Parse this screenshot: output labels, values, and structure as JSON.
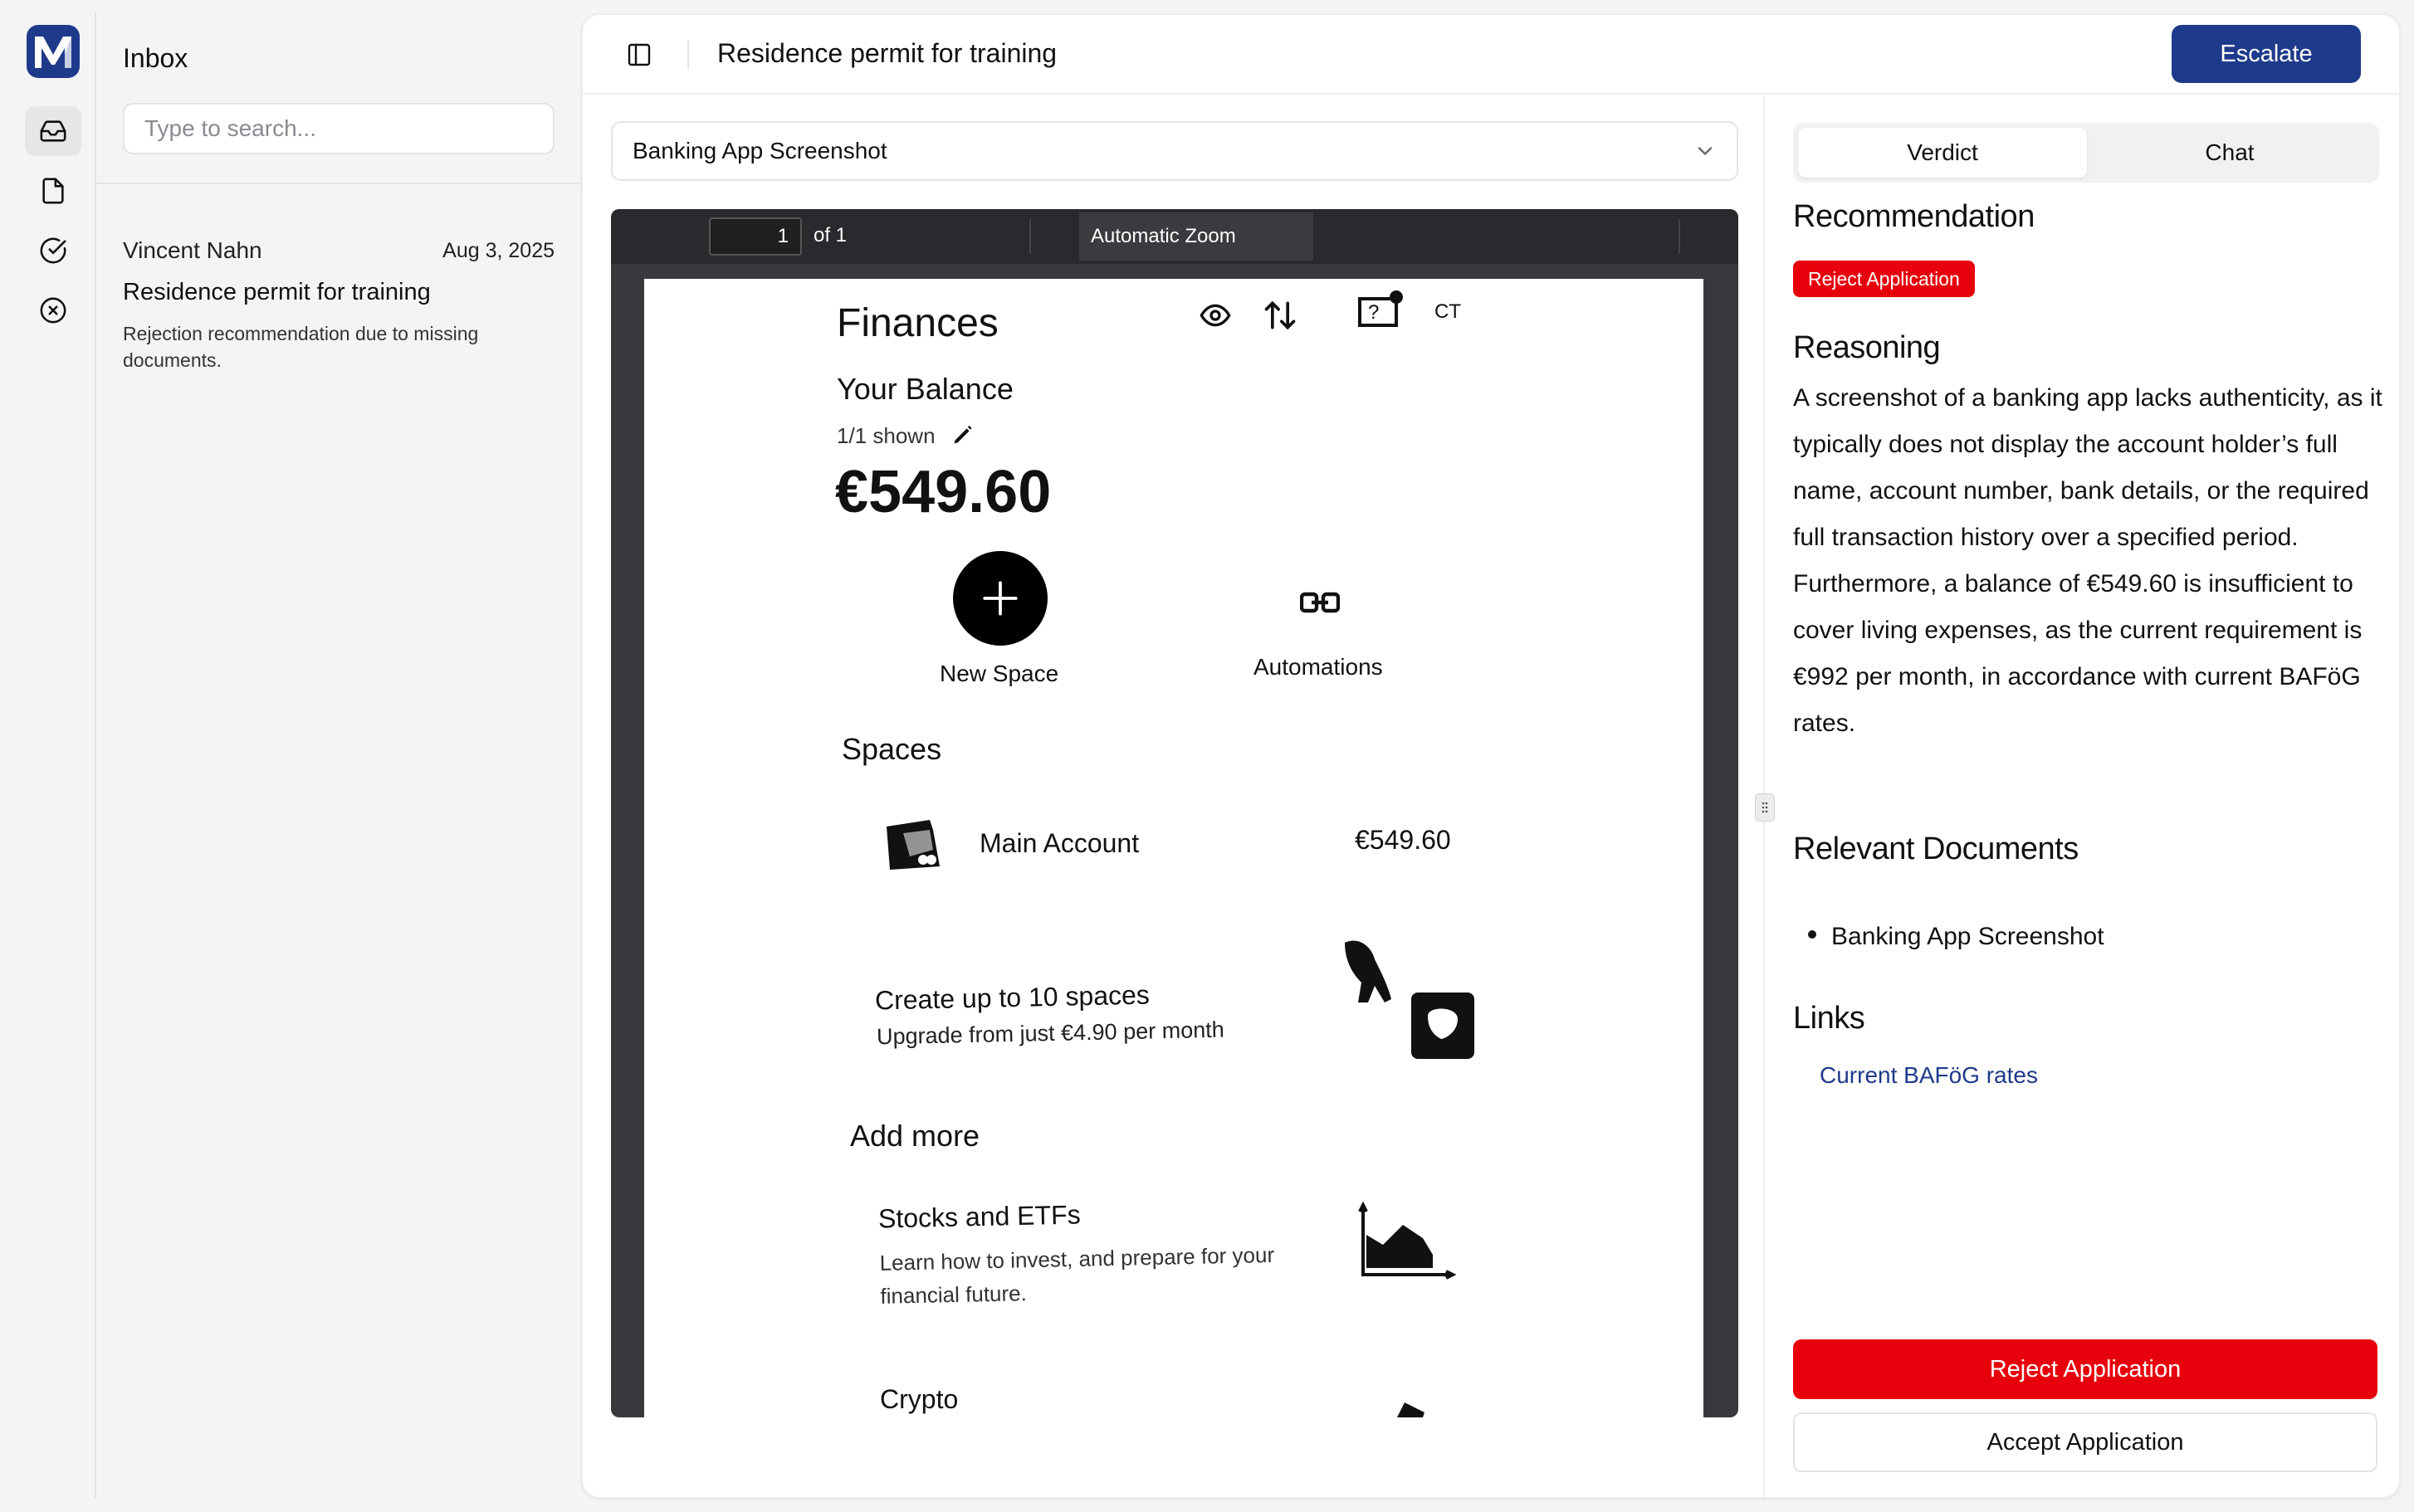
{
  "app": {
    "logo_icon": "logo-icon",
    "brand_color": "#1e3a8a"
  },
  "rail": {
    "items": [
      {
        "name": "inbox",
        "icon": "inbox-icon",
        "active": true
      },
      {
        "name": "documents",
        "icon": "file-icon",
        "active": false
      },
      {
        "name": "approved",
        "icon": "check-circle-icon",
        "active": false
      },
      {
        "name": "rejected",
        "icon": "x-circle-icon",
        "active": false
      }
    ]
  },
  "inbox": {
    "title": "Inbox",
    "search_placeholder": "Type to search...",
    "items": [
      {
        "sender": "Vincent Nahn",
        "date": "Aug 3, 2025",
        "title": "Residence permit for training",
        "snippet": "Rejection recommendation due to missing documents."
      }
    ]
  },
  "header": {
    "title": "Residence permit for training",
    "escalate_label": "Escalate"
  },
  "document": {
    "selected": "Banking App Screenshot",
    "viewer": {
      "page_number": "1",
      "page_of": "of 1",
      "zoom": "Automatic Zoom"
    },
    "page": {
      "finances": "Finances",
      "ct": "CT",
      "your_balance": "Your Balance",
      "shown": "1/1 shown",
      "balance_amount": "€549.60",
      "new_space": "New Space",
      "automations": "Automations",
      "spaces": "Spaces",
      "main_account": "Main Account",
      "main_account_amount": "€549.60",
      "create_spaces": "Create up to 10 spaces",
      "upgrade": "Upgrade from just €4.90 per month",
      "add_more": "Add more",
      "stocks": "Stocks and ETFs",
      "stocks_desc": "Learn how to invest, and prepare for your financial future.",
      "crypto": "Crypto"
    }
  },
  "verdict": {
    "tabs": [
      {
        "label": "Verdict",
        "active": true
      },
      {
        "label": "Chat",
        "active": false
      }
    ],
    "recommendation_heading": "Recommendation",
    "recommendation_badge": "Reject Application",
    "reasoning_heading": "Reasoning",
    "reasoning_text": "A screenshot of a banking app lacks authenticity, as it typically does not display the account holder’s full name, account number, bank details, or the required full transaction history over a specified period. Furthermore, a balance of €549.60 is insufficient to cover living expenses, as the current requirement is €992 per month, in accordance with current BAFöG rates.",
    "relevant_docs_heading": "Relevant Documents",
    "relevant_docs": [
      "Banking App Screenshot"
    ],
    "links_heading": "Links",
    "links": [
      "Current BAFöG rates"
    ],
    "reject_label": "Reject Application",
    "accept_label": "Accept Application",
    "reject_color": "#e7000b"
  }
}
